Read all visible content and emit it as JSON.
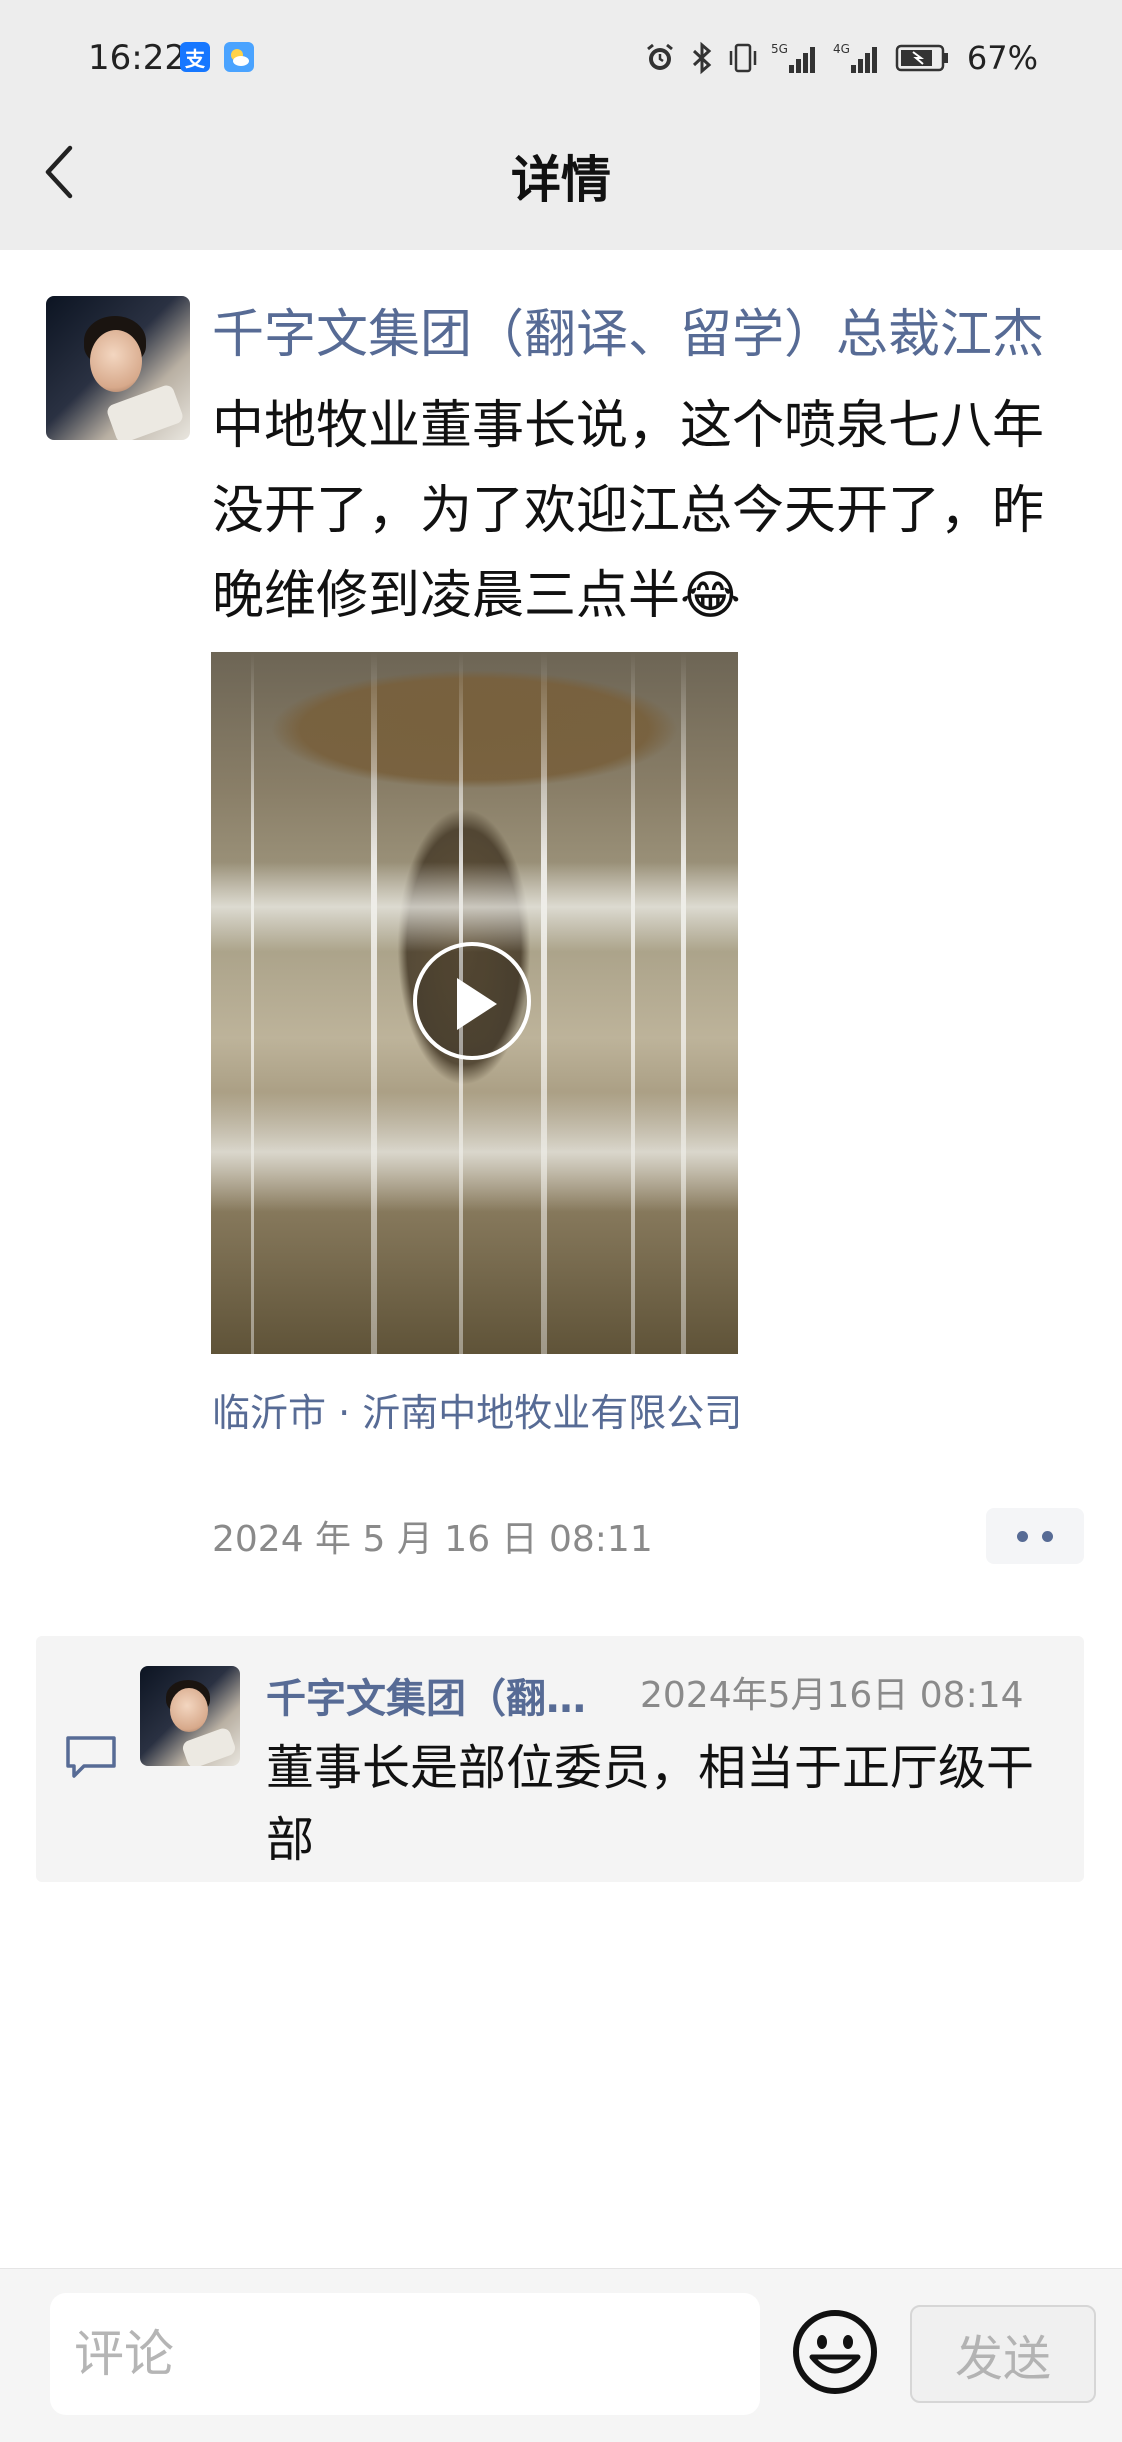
{
  "status_bar": {
    "time": "16:22",
    "app_icons": [
      "alipay-icon",
      "weather-icon"
    ],
    "icons": [
      "alarm-icon",
      "bluetooth-icon",
      "vibrate-icon",
      "signal-5g-icon",
      "signal-4g-icon",
      "battery-icon"
    ],
    "network_5g": "5G",
    "network_4g": "4G",
    "battery": "67%",
    "alipay_glyph": "支"
  },
  "header": {
    "title": "详情",
    "back_icon": "chevron-left-icon"
  },
  "post": {
    "author": "千字文集团（翻译、留学）总裁江杰",
    "text": "中地牧业董事长说，这个喷泉七八年没开了，为了欢迎江总今天开了，昨晚维修到凌晨三点半",
    "emoji": "😂",
    "media": {
      "type": "video",
      "play_icon": "play-icon"
    },
    "location": "临沂市 · 沂南中地牧业有限公司",
    "timestamp": "2024 年 5 月 16 日 08:11",
    "more_icon": "more-dots-icon"
  },
  "comments": [
    {
      "icon": "comment-icon",
      "author": "千字文集团（翻译、留学）总裁江杰",
      "time": "2024年5月16日 08:14",
      "text": "董事长是部位委员，相当于正厅级干部"
    }
  ],
  "bottom_bar": {
    "input_placeholder": "评论",
    "emoji_icon": "smiley-icon",
    "send_label": "发送"
  },
  "colors": {
    "link": "#576b95",
    "header_bg": "#ededed",
    "comment_bg": "#f4f4f4",
    "secondary_text": "#8a8a8a"
  }
}
